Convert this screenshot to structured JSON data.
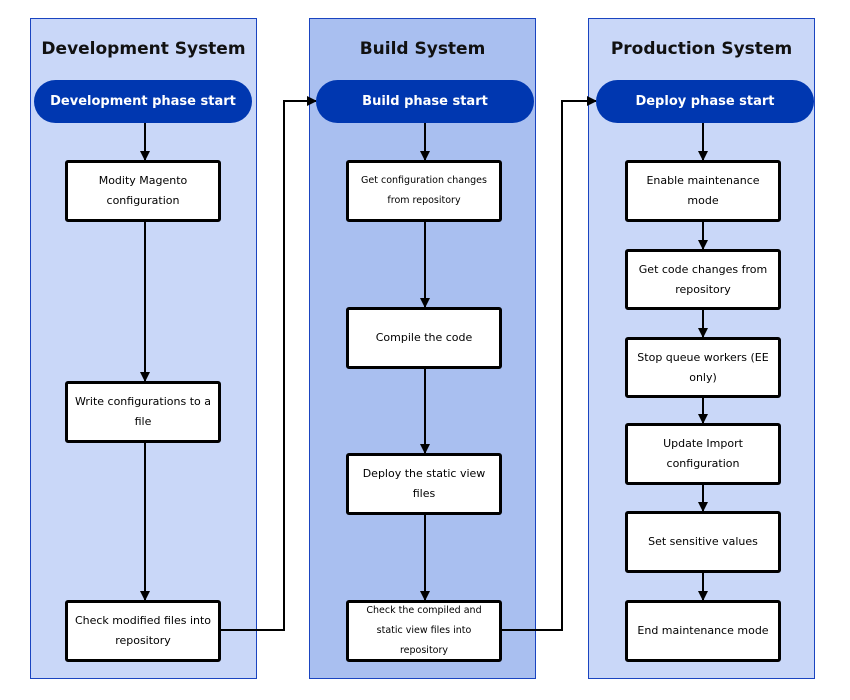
{
  "lanes": [
    {
      "title": "Development System",
      "start": "Development phase start",
      "steps": [
        "Modity Magento configuration",
        "Write configurations to a file",
        "Check modified files into repository"
      ]
    },
    {
      "title": "Build System",
      "start": "Build phase start",
      "steps": [
        "Get configuration changes from repository",
        "Compile the code",
        "Deploy the static view files",
        "Check the compiled and static view files into repository"
      ]
    },
    {
      "title": "Production System",
      "start": "Deploy phase start",
      "steps": [
        "Enable maintenance mode",
        "Get code changes from repository",
        "Stop queue workers (EE only)",
        "Update Import configuration",
        "Set sensitive values",
        "End maintenance mode"
      ]
    }
  ],
  "colors": {
    "lane_light": "#c9d7f8",
    "lane_dark": "#a9bff0",
    "pill": "#0037b0",
    "border": "#1a44c0"
  }
}
